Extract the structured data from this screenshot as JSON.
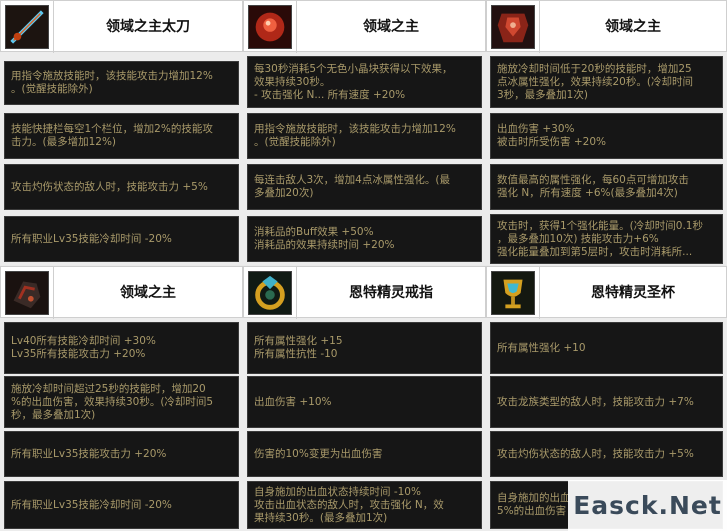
{
  "panels": [
    {
      "title": "领域之主太刀",
      "icon": "katana-weapon-icon",
      "rows": [
        [
          "用指令施放技能时，该技能攻击力增加12%",
          "。(觉醒技能除外)"
        ],
        [
          "技能快捷栏每空1个栏位，增加2%的技能攻",
          "击力。(最多增加12%)"
        ],
        [
          "攻击灼伤状态的敌人时，技能攻击力 +5%"
        ],
        [
          "所有职业Lv35技能冷却时间 -20%"
        ]
      ]
    },
    {
      "title": "领域之主",
      "icon": "red-gem-armor-icon",
      "rows": [
        [
          "每30秒消耗5个无色小晶块获得以下效果，",
          "效果持续30秒。",
          "- 攻击强化 N... 所有速度 +20%"
        ],
        [
          "用指令施放技能时，该技能攻击力增加12%",
          "。(觉醒技能除外)"
        ],
        [
          "每连击敌人3次，增加4点冰属性强化。(最",
          "多叠加20次)"
        ],
        [
          "消耗品的Buff效果 +50%",
          "消耗品的效果持续时间 +20%"
        ]
      ]
    },
    {
      "title": "领域之主",
      "icon": "red-chest-armor-icon",
      "rows": [
        [
          "施放冷却时间低于20秒的技能时，增加25",
          "点冰属性强化，效果持续20秒。(冷却时间",
          "3秒，最多叠加1次)"
        ],
        [
          "出血伤害 +30%",
          "被击时所受伤害 +20%"
        ],
        [
          "数值最高的属性强化，每60点可增加攻击",
          "强化 N，所有速度 +6%(最多叠加4次)"
        ],
        [
          "攻击时，获得1个强化能量。(冷却时间0.1秒",
          "，最多叠加10次)                技能攻击力+6%",
          "强化能量叠加到第5层时，攻击时消耗所..."
        ]
      ]
    },
    {
      "title": "领域之主",
      "icon": "dark-gauntlet-icon",
      "rows": [
        [
          "Lv40所有技能冷却时间 +30%",
          "Lv35所有技能攻击力 +20%"
        ],
        [
          "施放冷却时间超过25秒的技能时，增加20",
          "%的出血伤害，效果持续30秒。(冷却时间5",
          "秒，最多叠加1次)"
        ],
        [
          "所有职业Lv35技能攻击力 +20%"
        ],
        [
          "所有职业Lv35技能冷却时间 -20%"
        ]
      ]
    },
    {
      "title": "恩特精灵戒指",
      "icon": "spirit-ring-icon",
      "rows": [
        [
          "所有属性强化 +15",
          "所有属性抗性 -10"
        ],
        [
          "出血伤害 +10%"
        ],
        [
          "伤害的10%变更为出血伤害"
        ],
        [
          "自身施加的出血状态持续时间 -10%",
          "攻击出血状态的敌人时，攻击强化 N，效",
          "果持续30秒。(最多叠加1次)"
        ]
      ]
    },
    {
      "title": "恩特精灵圣杯",
      "icon": "spirit-grail-icon",
      "rows": [
        [
          "所有属性强化 +10"
        ],
        [
          "攻击龙族类型的敌人时，技能攻击力 +7%"
        ],
        [
          "攻击灼伤状态的敌人时，技能攻击力 +5%"
        ],
        [
          "自身施加的出血",
          "5%的出血伤害"
        ]
      ]
    }
  ],
  "watermark": "Easck.Net"
}
